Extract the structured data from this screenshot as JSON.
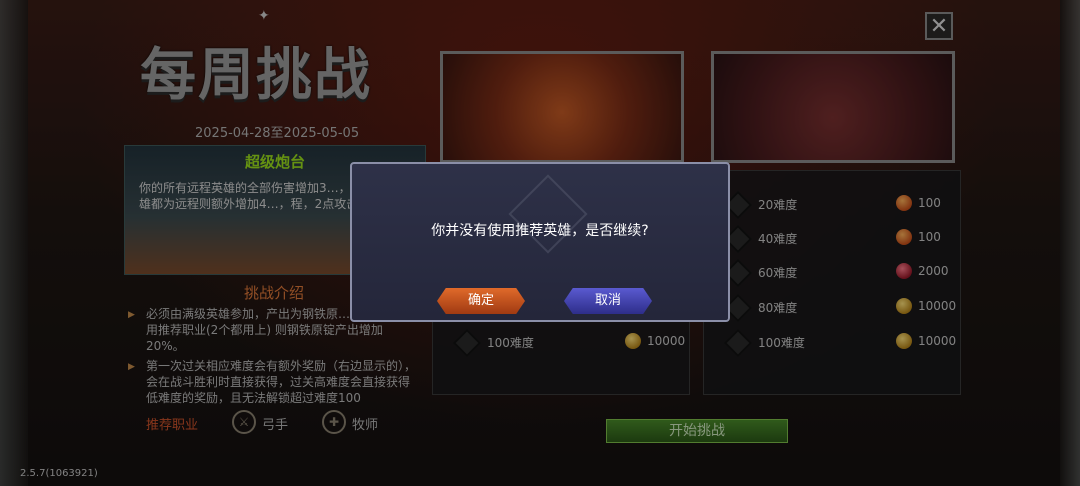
{
  "title": "每周挑战",
  "date_range": "2025-04-28至2025-05-05",
  "feature": {
    "title": "超级炮台",
    "desc": "你的所有远程英雄的全部伤害增加3…，你的所有英雄都为远程则额外增加4…，程，2点攻击目标数。"
  },
  "rules_title": "挑战介绍",
  "rules": [
    "必须由满级英雄参加，产出为钢铁原…章，如果使用推荐职业(2个都用上) 则钢铁原锭产出增加20%。",
    "第一次过关相应难度会有额外奖励（右边显示的），会在战斗胜利时直接获得，过关高难度会直接获得低难度的奖励，且无法解锁超过难度100"
  ],
  "recommended": {
    "label": "推荐职业",
    "classes": [
      {
        "name": "弓手",
        "icon": "archer-icon"
      },
      {
        "name": "牧师",
        "icon": "priest-icon"
      }
    ]
  },
  "left_rewards": [
    {
      "difficulty": "100难度",
      "amount": "10000",
      "coin": "gold"
    }
  ],
  "right_rewards": [
    {
      "difficulty": "20难度",
      "amount": "100",
      "coin": "orange"
    },
    {
      "difficulty": "40难度",
      "amount": "100",
      "coin": "orange"
    },
    {
      "difficulty": "60难度",
      "amount": "2000",
      "coin": "red"
    },
    {
      "difficulty": "80难度",
      "amount": "10000",
      "coin": "gold"
    },
    {
      "difficulty": "100难度",
      "amount": "10000",
      "coin": "gold"
    }
  ],
  "start_button": "开始挑战",
  "version": "2.5.7(1063921)",
  "dialog": {
    "message": "你并没有使用推荐英雄，是否继续?",
    "confirm": "确定",
    "cancel": "取消"
  },
  "close_icon": "close-icon"
}
